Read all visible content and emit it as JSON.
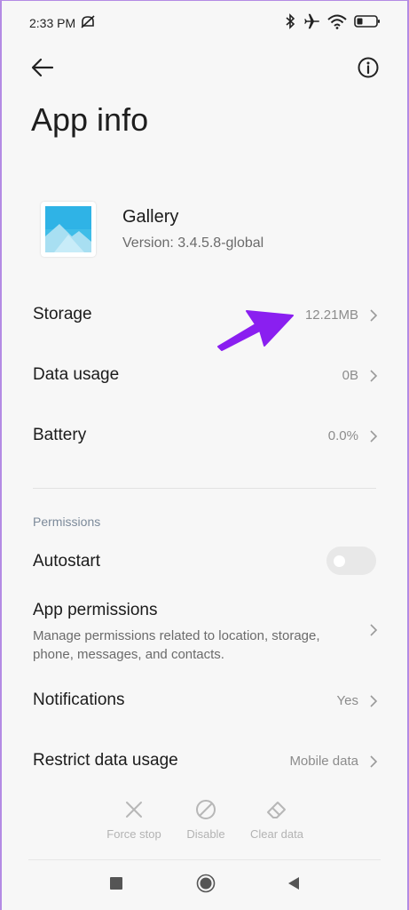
{
  "status_bar": {
    "time": "2:33 PM",
    "icons": [
      "mute-icon",
      "bluetooth-icon",
      "airplane-icon",
      "wifi-icon",
      "battery-icon"
    ]
  },
  "header": {
    "back_icon": "back-arrow-icon",
    "info_icon": "info-icon",
    "title": "App info"
  },
  "app": {
    "name": "Gallery",
    "version": "Version: 3.4.5.8-global"
  },
  "rows": {
    "storage": {
      "label": "Storage",
      "value": "12.21MB"
    },
    "data_usage": {
      "label": "Data usage",
      "value": "0B"
    },
    "battery": {
      "label": "Battery",
      "value": "0.0%"
    }
  },
  "permissions": {
    "section_label": "Permissions",
    "autostart": {
      "label": "Autostart",
      "enabled": false
    },
    "app_permissions": {
      "label": "App permissions",
      "description": "Manage permissions related to location, storage, phone, messages, and contacts."
    },
    "notifications": {
      "label": "Notifications",
      "value": "Yes"
    },
    "restrict_data": {
      "label": "Restrict data usage",
      "value": "Mobile data"
    }
  },
  "actions": {
    "force_stop": "Force stop",
    "disable": "Disable",
    "clear_data": "Clear data"
  },
  "nav": [
    "recents-square-icon",
    "home-circle-icon",
    "back-triangle-icon"
  ],
  "colors": {
    "annotation_arrow": "#8a1ff0",
    "toggle_off": "#e8e8e8"
  }
}
